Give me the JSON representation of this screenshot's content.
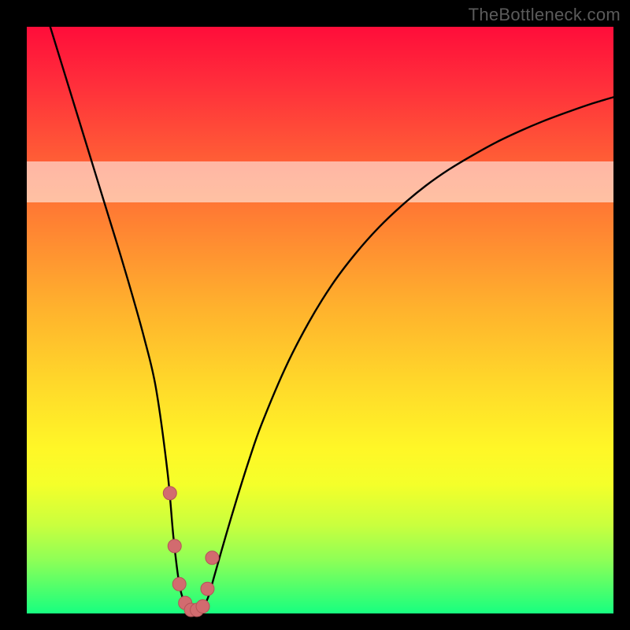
{
  "watermark": "TheBottleneck.com",
  "colors": {
    "frame": "#000000",
    "curve_line": "#000000",
    "dot_fill": "#d26b6f",
    "dot_stroke": "#b45458"
  },
  "chart_data": {
    "type": "line",
    "title": "",
    "xlabel": "",
    "ylabel": "",
    "xlim": [
      0,
      100
    ],
    "ylim": [
      0,
      100
    ],
    "legal_band_y": [
      70,
      77
    ],
    "series": [
      {
        "name": "bottleneck-curve",
        "x": [
          4,
          6,
          8,
          10,
          12,
          14,
          16,
          18,
          20,
          22,
          24,
          25,
          26,
          27,
          28,
          29,
          30,
          31,
          32,
          34,
          36,
          38,
          40,
          44,
          48,
          52,
          56,
          60,
          64,
          68,
          72,
          76,
          80,
          84,
          88,
          92,
          96,
          100
        ],
        "y": [
          100,
          93.5,
          87,
          80.5,
          74,
          67.5,
          61,
          54.2,
          47,
          38.5,
          24,
          13,
          5,
          1.5,
          0.5,
          0.5,
          1,
          3,
          6.5,
          13.5,
          20.2,
          26.5,
          32.2,
          41.7,
          49.5,
          56,
          61.3,
          65.8,
          69.6,
          72.9,
          75.7,
          78.1,
          80.3,
          82.2,
          83.9,
          85.4,
          86.8,
          88
        ]
      }
    ],
    "highlight_dots": {
      "name": "sweet-spot",
      "x": [
        24.4,
        25.2,
        26.0,
        27.0,
        28.0,
        29.0,
        30.0,
        30.8,
        31.6
      ],
      "y": [
        20.5,
        11.5,
        5.0,
        1.8,
        0.6,
        0.6,
        1.2,
        4.2,
        9.5
      ]
    }
  }
}
